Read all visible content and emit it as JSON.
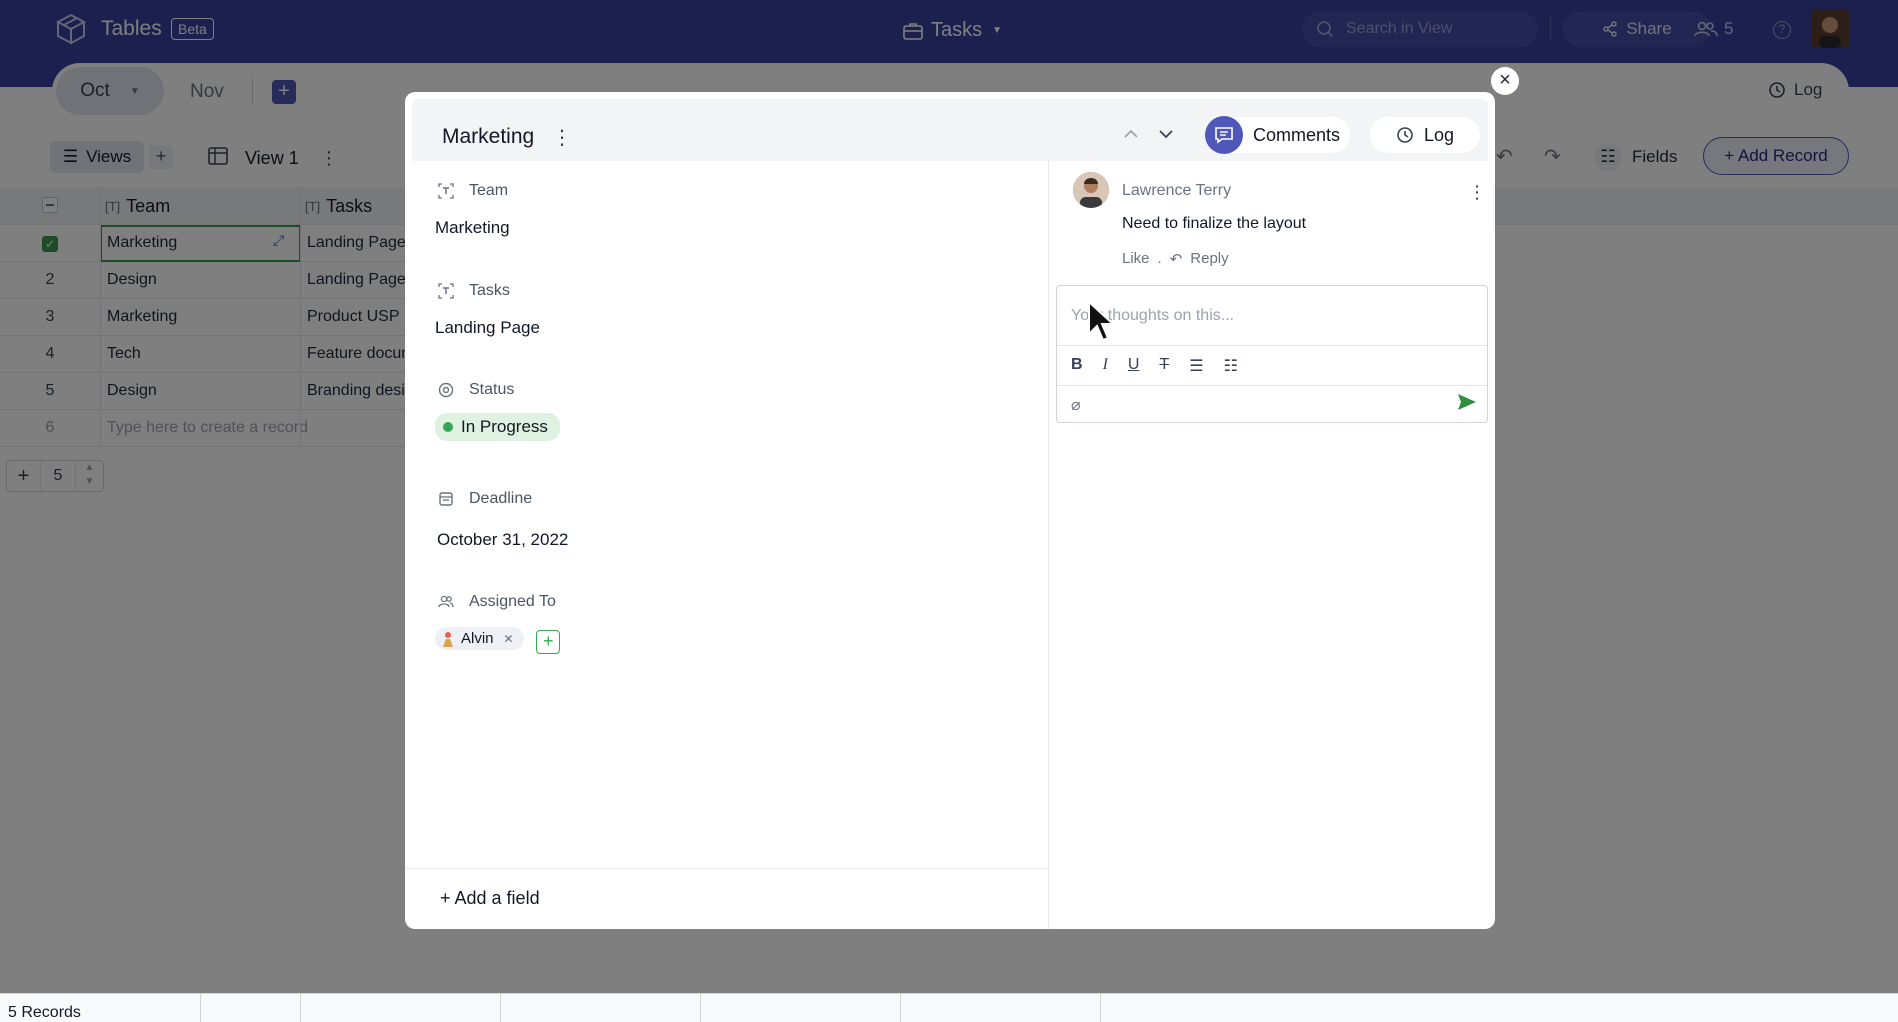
{
  "app": {
    "title": "Tables",
    "badge": "Beta",
    "base_name": "Tasks",
    "search_placeholder": "Search in View",
    "share_label": "Share",
    "member_count": "5"
  },
  "months": {
    "active": "Oct",
    "other": "Nov",
    "log_label": "Log"
  },
  "toolbar": {
    "views_label": "Views",
    "view_name": "View 1",
    "fields_label": "Fields",
    "add_record_label": "+ Add Record"
  },
  "grid": {
    "columns": [
      "Team",
      "Tasks"
    ],
    "rows": [
      {
        "num": "",
        "team": "Marketing",
        "task": "Landing Page"
      },
      {
        "num": "2",
        "team": "Design",
        "task": "Landing Page"
      },
      {
        "num": "3",
        "team": "Marketing",
        "task": "Product USP"
      },
      {
        "num": "4",
        "team": "Tech",
        "task": "Feature docum"
      },
      {
        "num": "5",
        "team": "Design",
        "task": "Branding desig"
      },
      {
        "num": "6",
        "team": "Type here to create a record",
        "task": ""
      }
    ],
    "page_size": "5",
    "records_count": "5 Records"
  },
  "modal": {
    "title": "Marketing",
    "comments_label": "Comments",
    "log_label": "Log",
    "fields": {
      "team": {
        "label": "Team",
        "value": "Marketing"
      },
      "tasks": {
        "label": "Tasks",
        "value": "Landing Page"
      },
      "status": {
        "label": "Status",
        "value": "In Progress",
        "color": "#34a853"
      },
      "deadline": {
        "label": "Deadline",
        "value": "October 31, 2022"
      },
      "assigned": {
        "label": "Assigned To",
        "user": "Alvin"
      }
    },
    "add_field_label": "+ Add a field",
    "comment": {
      "author": "Lawrence Terry",
      "text": "Need to finalize the layout",
      "like": "Like",
      "separator": ".",
      "reply": "Reply"
    },
    "editor_placeholder": "Your thoughts on this..."
  },
  "colors": {
    "topbar": "#38419d",
    "accent": "#4f57b8",
    "success": "#34a853"
  }
}
